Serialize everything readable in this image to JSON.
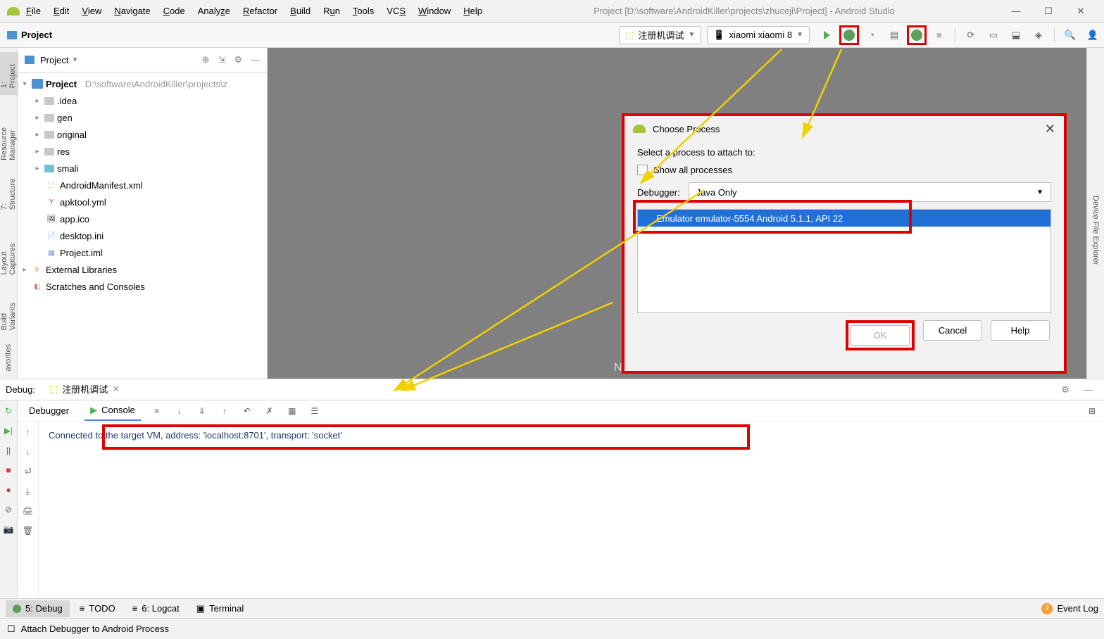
{
  "menu": {
    "items": [
      "File",
      "Edit",
      "View",
      "Navigate",
      "Code",
      "Analyze",
      "Refactor",
      "Build",
      "Run",
      "Tools",
      "VCS",
      "Window",
      "Help"
    ]
  },
  "window_title": "Project [D:\\software\\AndroidKiller\\projects\\zhuceji\\Project] - Android Studio",
  "crumb": "Project",
  "run_config": "注册机调试",
  "device": "xiaomi xiaomi 8",
  "project_panel": {
    "title": "Project"
  },
  "tree": {
    "root": "Project",
    "root_path": "D:\\software\\AndroidKiller\\projects\\z",
    "folders": [
      ".idea",
      "gen",
      "original",
      "res",
      "smali"
    ],
    "files": [
      "AndroidManifest.xml",
      "apktool.yml",
      "app.ico",
      "desktop.ini",
      "Project.iml"
    ],
    "ext_libs": "External Libraries",
    "scratches": "Scratches and Consoles"
  },
  "dialog": {
    "title": "Choose Process",
    "prompt": "Select a process to attach to:",
    "show_all": "Show all processes",
    "debugger_label": "Debugger:",
    "debugger_value": "Java Only",
    "process": "Emulator emulator-5554 Android 5.1.1, API 22",
    "ok": "OK",
    "cancel": "Cancel",
    "help": "Help"
  },
  "debug": {
    "label": "Debug:",
    "tab": "注册机调试",
    "debugger_tab": "Debugger",
    "console_tab": "Console",
    "message": "Connected to the target VM, address: 'localhost:8701', transport: 'socket'"
  },
  "bottom": {
    "debug": "5: Debug",
    "todo": "TODO",
    "logcat": "6: Logcat",
    "terminal": "Terminal",
    "eventlog": "Event Log",
    "badge": "2"
  },
  "status": "Attach Debugger to Android Process",
  "side_left": {
    "project": "1: Project",
    "resmgr": "Resource Manager",
    "structure": "7: Structure",
    "captures": "Layout Captures",
    "variants": "Build Variants",
    "favorites": "avorites"
  },
  "side_right": {
    "dfe": "Device File Explorer"
  },
  "nav_bar_hint": "Navigation Bar  Alt+Home"
}
